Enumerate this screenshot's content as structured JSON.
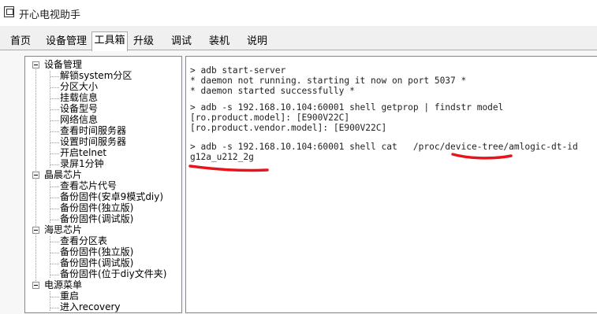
{
  "window": {
    "title": "开心电视助手",
    "app_icon": "app-window-icon"
  },
  "tabs": [
    {
      "label": "首页"
    },
    {
      "label": "设备管理"
    },
    {
      "label": "工具箱",
      "selected": true
    },
    {
      "label": "升级"
    },
    {
      "label": "调试"
    },
    {
      "label": "装机"
    },
    {
      "label": "说明"
    }
  ],
  "tree": {
    "groups": [
      {
        "label": "设备管理",
        "items": [
          "解锁system分区",
          "分区大小",
          "挂载信息",
          "设备型号",
          "网络信息",
          "查看时间服务器",
          "设置时间服务器",
          "开启telnet",
          "录屏1分钟"
        ]
      },
      {
        "label": "晶晨芯片",
        "items": [
          "查看芯片代号",
          "备份固件(安卓9模式diy)",
          "备份固件(独立版)",
          "备份固件(调试版)"
        ]
      },
      {
        "label": "海思芯片",
        "items": [
          "查看分区表",
          "备份固件(独立版)",
          "备份固件(调试版)",
          "备份固件(位于diy文件夹)"
        ]
      },
      {
        "label": "电源菜单",
        "items": [
          "重启",
          "进入recovery"
        ]
      }
    ]
  },
  "console": {
    "lines": [
      "> adb start-server",
      "* daemon not running. starting it now on port 5037 *",
      "* daemon started successfully *",
      "",
      "> adb -s 192.168.10.104:60001 shell getprop | findstr model",
      "[ro.product.model]: [E900V22C]",
      "[ro.product.vendor.model]: [E900V22C]",
      "",
      "> adb -s 192.168.10.104:60001 shell cat   /proc/device-tree/amlogic-dt-id",
      "g12a_u212_2g"
    ],
    "annotation_color": "#e8141c"
  },
  "colors": {
    "window_bg": "#f0f0f0",
    "panel_bg": "#ffffff",
    "border": "#828790"
  }
}
